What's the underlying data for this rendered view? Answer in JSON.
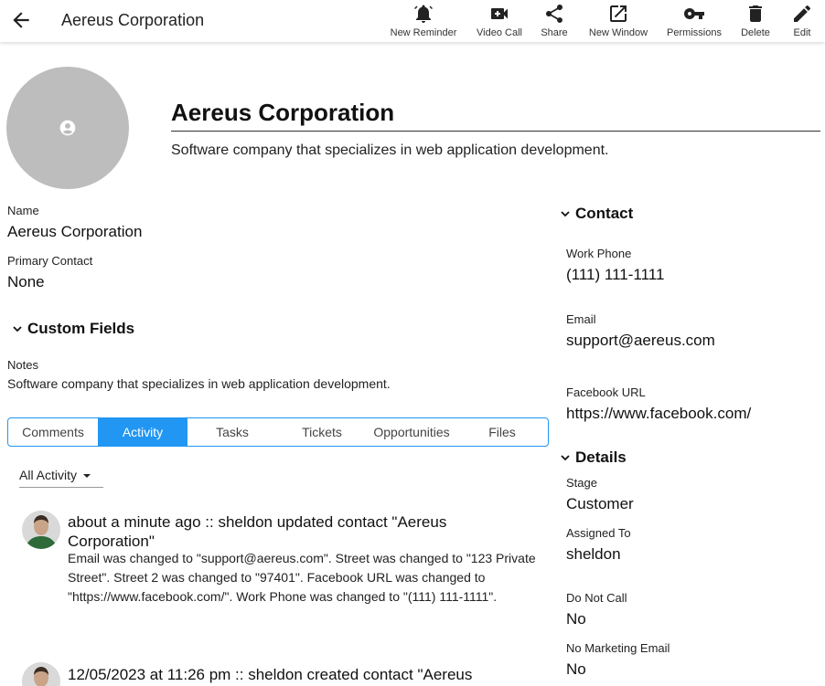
{
  "topbar": {
    "title": "Aereus Corporation",
    "actions": [
      {
        "label": "New Reminder",
        "icon": "alarm-bell-icon"
      },
      {
        "label": "Video Call",
        "icon": "video-call-icon"
      },
      {
        "label": "Share",
        "icon": "share-icon"
      },
      {
        "label": "New Window",
        "icon": "open-in-new-icon"
      },
      {
        "label": "Permissions",
        "icon": "key-icon"
      },
      {
        "label": "Delete",
        "icon": "trash-icon"
      },
      {
        "label": "Edit",
        "icon": "pencil-icon"
      }
    ]
  },
  "profile": {
    "name": "Aereus Corporation",
    "description": "Software company that specializes in web application development."
  },
  "fields": {
    "name_label": "Name",
    "name_value": "Aereus Corporation",
    "primary_contact_label": "Primary Contact",
    "primary_contact_value": "None"
  },
  "custom_fields": {
    "heading": "Custom Fields",
    "notes_label": "Notes",
    "notes_value": "Software company that specializes in web application development."
  },
  "tabs": [
    {
      "label": "Comments",
      "active": false
    },
    {
      "label": "Activity",
      "active": true
    },
    {
      "label": "Tasks",
      "active": false
    },
    {
      "label": "Tickets",
      "active": false
    },
    {
      "label": "Opportunities",
      "active": false
    },
    {
      "label": "Files",
      "active": false
    }
  ],
  "activity_filter": {
    "label": "All Activity"
  },
  "activities": [
    {
      "title": "about a minute ago :: sheldon updated contact \"Aereus Corporation\"",
      "body": "Email was changed to \"support@aereus.com\". Street was changed to \"123 Private Street\". Street 2 was changed to \"97401\". Facebook URL was changed to \"https://www.facebook.com/\". Work Phone was changed to \"(111) 111-1111\"."
    },
    {
      "title": "12/05/2023 at 11:26 pm :: sheldon created contact \"Aereus",
      "body": ""
    }
  ],
  "contact": {
    "heading": "Contact",
    "work_phone_label": "Work Phone",
    "work_phone_value": "(111) 111-1111",
    "email_label": "Email",
    "email_value": "support@aereus.com",
    "facebook_label": "Facebook URL",
    "facebook_value": "https://www.facebook.com/"
  },
  "details": {
    "heading": "Details",
    "stage_label": "Stage",
    "stage_value": "Customer",
    "assigned_label": "Assigned To",
    "assigned_value": "sheldon",
    "dnc_label": "Do Not Call",
    "dnc_value": "No",
    "nme_label": "No Marketing Email",
    "nme_value": "No"
  },
  "colors": {
    "accent": "#2196f3",
    "avatar_bg": "#bdbdbd"
  }
}
